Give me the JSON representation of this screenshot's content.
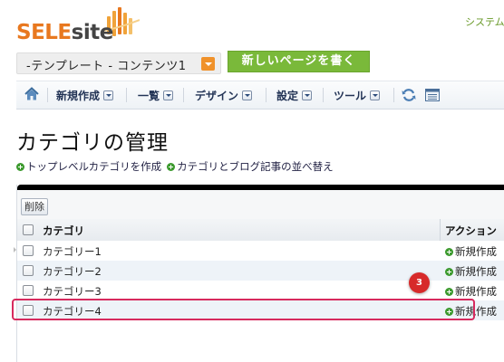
{
  "header": {
    "logo_text_primary": "SELE",
    "logo_text_secondary": "site",
    "system_link": "システム"
  },
  "site_selector": {
    "value": "-テンプレート - コンテンツ1"
  },
  "new_page_button": {
    "label": "新しいページを書く"
  },
  "nav": {
    "items": [
      {
        "label": "新規作成"
      },
      {
        "label": "一覧"
      },
      {
        "label": "デザイン"
      },
      {
        "label": "設定"
      },
      {
        "label": "ツール"
      }
    ]
  },
  "page": {
    "title": "カテゴリの管理",
    "links": [
      {
        "label": "トップレベルカテゴリを作成"
      },
      {
        "label": "カテゴリとブログ記事の並べ替え"
      }
    ]
  },
  "table": {
    "delete_button": "削除",
    "columns": {
      "category": "カテゴリ",
      "action": "アクション"
    },
    "rows": [
      {
        "label": "カテゴリー1",
        "action": "新規作成"
      },
      {
        "label": "カテゴリー2",
        "action": "新規作成"
      },
      {
        "label": "カテゴリー3",
        "action": "新規作成"
      },
      {
        "label": "カテゴリー4",
        "action": "新規作成"
      }
    ]
  },
  "annotation": {
    "step_number": "3"
  },
  "colors": {
    "accent_orange": "#e8781f",
    "new_page_green": "#7ab93a",
    "highlight_pink": "#d72a5e",
    "badge_red": "#d72a2a"
  },
  "icons": [
    "home-icon",
    "refresh-icon",
    "list-view-icon",
    "plus-circle-icon",
    "dropdown-caret-icon"
  ]
}
